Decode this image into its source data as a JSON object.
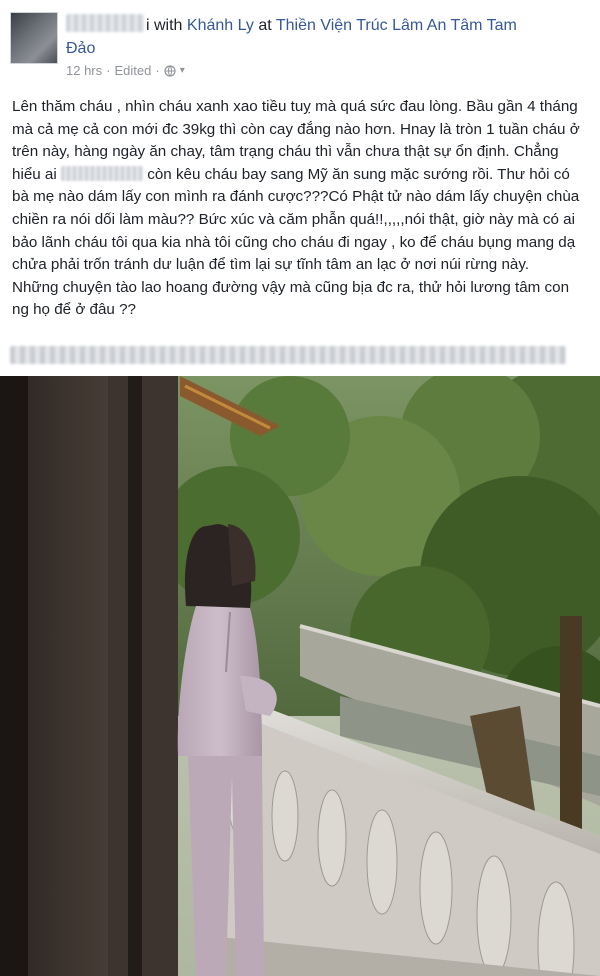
{
  "post": {
    "author_suffix": "i with",
    "with_name": "Khánh Ly",
    "at_word": "at",
    "place_line1": "Thiền Viện Trúc Lâm An Tâm Tam",
    "place_line2": "Đảo",
    "time": "12 hrs",
    "separator": "·",
    "edited": "Edited",
    "separator2": "·",
    "privacy_icon": "globe-icon",
    "menu_icon": "chevron-down-icon"
  },
  "body": {
    "p1_part1": "Lên thăm cháu , nhìn cháu xanh xao tiều tuỵ mà quá sức đau lòng. Bầu gần 4 tháng mà cả mẹ cả con mới đc 39kg thì còn cay đắng nào hơn. Hnay là tròn 1 tuần cháu ở trên này, hàng ngày ăn chay, tâm trạng cháu thì vẫn chưa thật sự ổn định. Chẳng hiểu ai",
    "p1_part2": "còn kêu cháu bay sang Mỹ ăn sung mặc sướng rồi. Thư hỏi có bà mẹ nào dám lấy con mình ra đánh cược???Có Phật tử nào dám lấy chuyện chùa chiền ra nói dối làm màu?? Bức xúc và căm phẫn quá!!,,,,,nói thật, giờ này mà có ai bảo lãnh cháu tôi qua kia nhà tôi cũng cho cháu đi ngay , ko để cháu bụng mang dạ chửa phải trốn tránh dư luận để tìm lại sự tĩnh tâm an lạc ở nơi núi rừng này.",
    "p2": "Những chuyện tào lao hoang đường vậy mà cũng bịa đc ra, thử hỏi lương tâm con ng họ để ở đâu ??"
  },
  "colors": {
    "link": "#365899",
    "meta": "#90949c",
    "text": "#1d2129"
  }
}
